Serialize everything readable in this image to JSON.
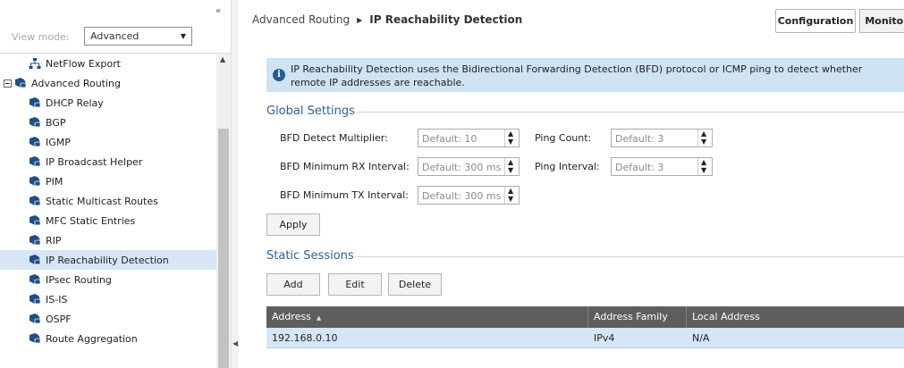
{
  "sidebar": {
    "collapse_glyph": "«",
    "view_mode_label": "View mode:",
    "view_mode_value": "Advanced",
    "tree": [
      {
        "label": "NetFlow Export",
        "icon": "netflow-icon",
        "indent": 1,
        "selected": false
      },
      {
        "label": "Advanced Routing",
        "icon": "routing-group-icon",
        "indent": 0,
        "expander": true,
        "selected": false
      },
      {
        "label": "DHCP Relay",
        "icon": "routing-lock-icon",
        "indent": 1,
        "selected": false
      },
      {
        "label": "BGP",
        "icon": "routing-lock-icon",
        "indent": 1,
        "selected": false
      },
      {
        "label": "IGMP",
        "icon": "routing-lock-icon",
        "indent": 1,
        "selected": false
      },
      {
        "label": "IP Broadcast Helper",
        "icon": "routing-lock-icon",
        "indent": 1,
        "selected": false
      },
      {
        "label": "PIM",
        "icon": "routing-lock-icon",
        "indent": 1,
        "selected": false
      },
      {
        "label": "Static Multicast Routes",
        "icon": "routing-lock-icon",
        "indent": 1,
        "selected": false
      },
      {
        "label": "MFC Static Entries",
        "icon": "routing-lock-icon",
        "indent": 1,
        "selected": false
      },
      {
        "label": "RIP",
        "icon": "routing-lock-icon",
        "indent": 1,
        "selected": false
      },
      {
        "label": "IP Reachability Detection",
        "icon": "routing-lock-icon",
        "indent": 1,
        "selected": true
      },
      {
        "label": "IPsec Routing",
        "icon": "routing-lock-icon",
        "indent": 1,
        "selected": false
      },
      {
        "label": "IS-IS",
        "icon": "routing-lock-icon",
        "indent": 1,
        "selected": false
      },
      {
        "label": "OSPF",
        "icon": "routing-lock-icon",
        "indent": 1,
        "selected": false
      },
      {
        "label": "Route Aggregation",
        "icon": "routing-lock-icon",
        "indent": 1,
        "selected": false
      }
    ]
  },
  "breadcrumb": {
    "root": "Advanced Routing",
    "current": "IP Reachability Detection"
  },
  "top_buttons": {
    "configuration": "Configuration",
    "monitor": "Monitor"
  },
  "info": {
    "text": "IP Reachability Detection uses the Bidirectional Forwarding Detection (BFD) protocol or ICMP ping to detect whether remote IP addresses are reachable."
  },
  "global_settings": {
    "title": "Global Settings",
    "bfd_multiplier_label": "BFD Detect Multiplier:",
    "bfd_multiplier_value": "Default: 10",
    "bfd_rx_label": "BFD Minimum RX Interval:",
    "bfd_rx_value": "Default: 300 ms",
    "bfd_tx_label": "BFD Minimum TX Interval:",
    "bfd_tx_value": "Default: 300 ms",
    "ping_count_label": "Ping Count:",
    "ping_count_value": "Default: 3",
    "ping_interval_label": "Ping Interval:",
    "ping_interval_value": "Default: 3",
    "apply_label": "Apply"
  },
  "static_sessions": {
    "title": "Static Sessions",
    "add_label": "Add",
    "edit_label": "Edit",
    "delete_label": "Delete",
    "columns": [
      "Address",
      "Address Family",
      "Local Address"
    ],
    "rows": [
      [
        "192.168.0.10",
        "IPv4",
        "N/A"
      ]
    ]
  },
  "colors": {
    "accent": "#2b5f98",
    "selection": "#d6e6f7",
    "info_bg": "#cfe3f3",
    "grid_header": "#5e5e5e"
  }
}
